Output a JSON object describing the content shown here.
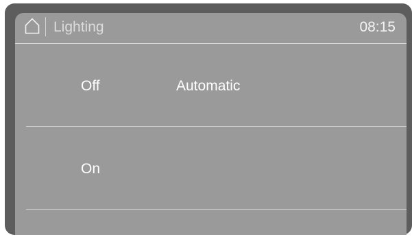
{
  "header": {
    "home_icon": "home-icon",
    "title": "Lighting",
    "time": "08:15"
  },
  "options": [
    {
      "label": "Off",
      "value": "Automatic"
    },
    {
      "label": "On",
      "value": ""
    }
  ],
  "colors": {
    "bezel": "#5d5d5d",
    "screen": "#9a9a9a",
    "text": "#ffffff",
    "divider": "#d6d6d6"
  }
}
